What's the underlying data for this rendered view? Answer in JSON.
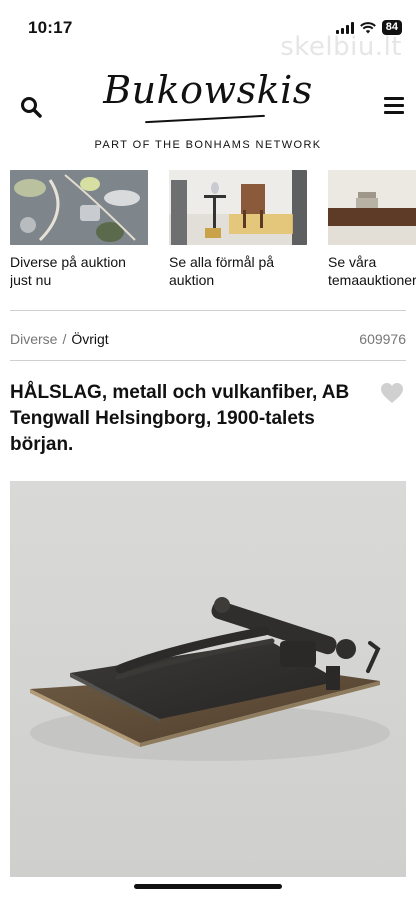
{
  "status": {
    "time": "10:17",
    "battery": "84"
  },
  "watermark": "skelbiu.lt",
  "header": {
    "logo": "Bukowskis",
    "tagline": "PART OF THE BONHAMS NETWORK"
  },
  "carousel": [
    {
      "label": "Diverse på auktion just nu"
    },
    {
      "label": "Se alla förmål på auktion"
    },
    {
      "label": "Se våra temaauktioner"
    }
  ],
  "breadcrumb": {
    "parent": "Diverse",
    "separator": "/",
    "current": "Övrigt"
  },
  "lot_number": "609976",
  "item": {
    "title": "HÅLSLAG, metall och vulkanfiber, AB Tengwall Helsingborg, 1900-talets början."
  },
  "colors": {
    "text": "#111111",
    "muted": "#777777",
    "divider": "#cfcfcf",
    "image_bg": "#d6d6d4"
  },
  "icons": {
    "search": "search-icon",
    "menu": "menu-icon",
    "favorite": "heart-icon"
  }
}
